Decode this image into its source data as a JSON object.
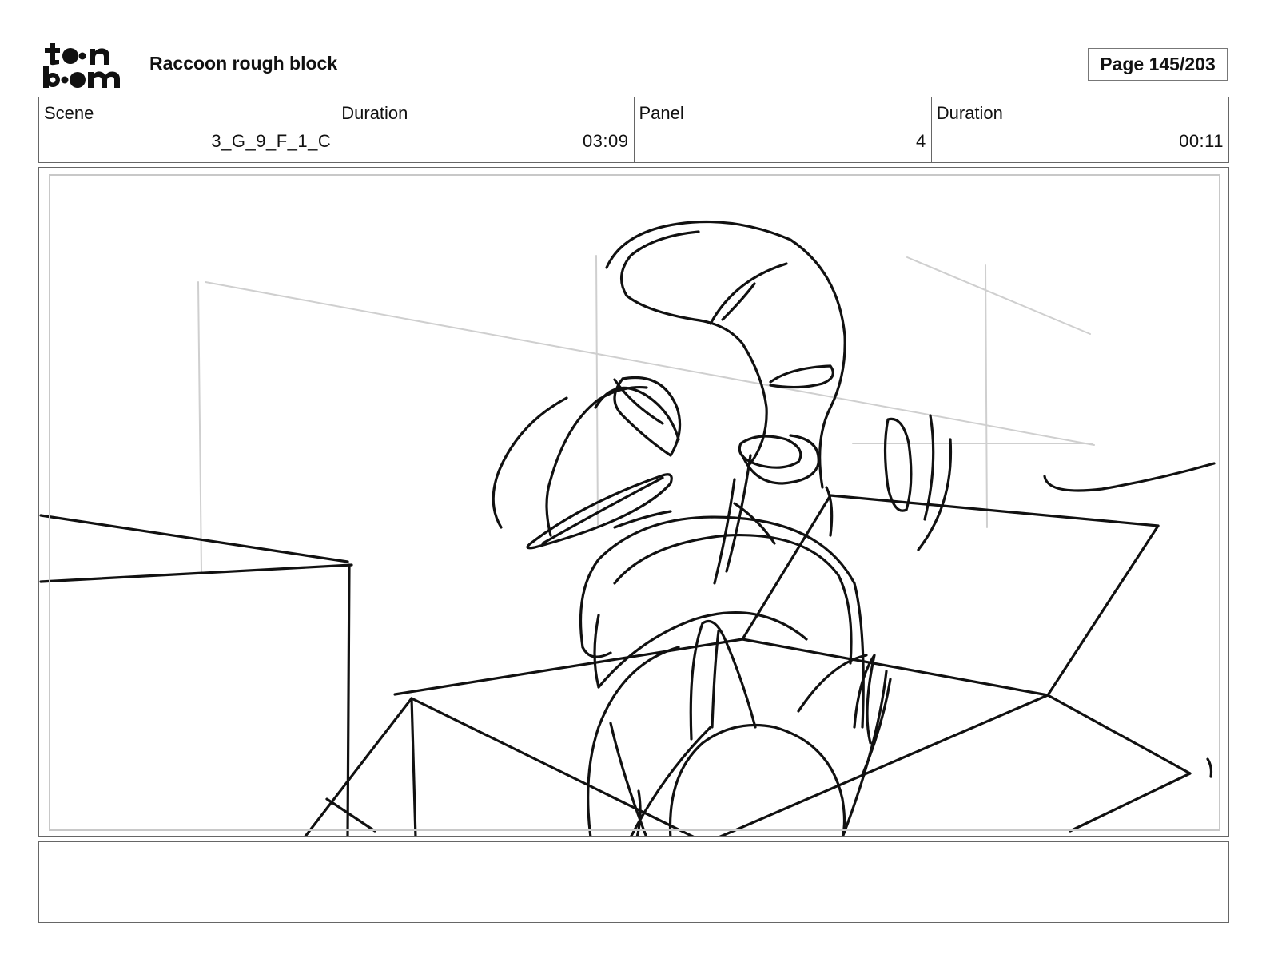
{
  "header": {
    "logo_text": "toon boom",
    "title": "Raccoon rough block",
    "page_label": "Page 145/203"
  },
  "info": [
    {
      "label": "Scene",
      "value": "3_G_9_F_1_C"
    },
    {
      "label": "Duration",
      "value": "03:09"
    },
    {
      "label": "Panel",
      "value": "4"
    },
    {
      "label": "Duration",
      "value": "00:11"
    }
  ],
  "panel": {
    "description": "Rough pencil storyboard sketch of a raccoon character rising out of a cardboard box",
    "stroke_color": "#111111",
    "guide_color": "#cfcfcf"
  },
  "notes": {
    "text": ""
  }
}
